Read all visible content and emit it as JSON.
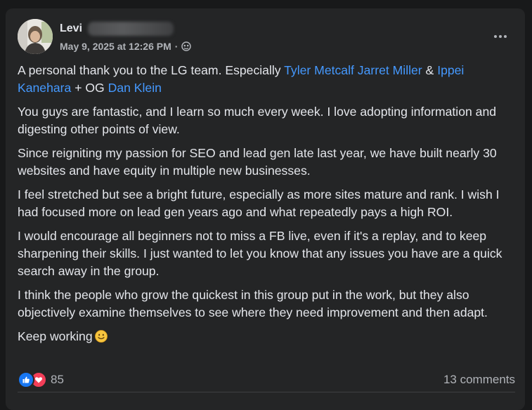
{
  "post": {
    "author": "Levi",
    "date": "May 9, 2025 at 12:26 PM",
    "separator": "·",
    "privacy_icon": "globe-icon",
    "more_icon": "more-horizontal-icon"
  },
  "content": {
    "p1_start": "A personal thank you to the LG team. Especially ",
    "mention_1": "Tyler Metcalf",
    "mention_2": "Jarret Miller",
    "amp": " & ",
    "mention_3": "Ippei Kanehara",
    "plus_og": " + OG ",
    "mention_4": "Dan Klein",
    "p2": "You guys are fantastic, and I learn so much every week. I love adopting information and digesting other points of view.",
    "p3": "Since reigniting my passion for SEO and lead gen late last year, we have built nearly 30 websites and have equity in multiple new businesses.",
    "p4": "I feel stretched but see a bright future, especially as more sites mature and rank. I wish I had focused more on lead gen years ago and what repeatedly pays a high ROI.",
    "p5": "I would encourage all beginners not to miss a FB live, even if it's a replay, and to keep sharpening their skills. I just wanted to let you know that any issues you have are a quick search away in the group.",
    "p6": "I think the people who grow the quickest in this group put in the work, but they also objectively examine themselves to see where they need improvement and then adapt.",
    "p7": "Keep working",
    "emoji": "slightly-smiling-face-icon"
  },
  "footer": {
    "reaction_icons": [
      "like-icon",
      "love-icon"
    ],
    "reaction_count": "85",
    "comments": "13 comments"
  },
  "colors": {
    "background": "#18191a",
    "card": "#242526",
    "text": "#e4e6eb",
    "secondary": "#b0b3b8",
    "mention": "#4599ff",
    "like": "#1877f2",
    "love": "#f33e58"
  }
}
